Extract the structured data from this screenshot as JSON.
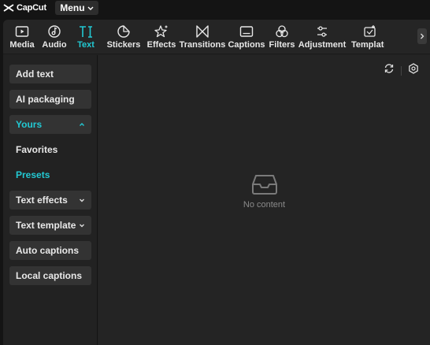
{
  "app": {
    "name": "CapCut",
    "menu_label": "Menu"
  },
  "toolbar": {
    "tools": [
      {
        "label": "Media",
        "icon": "media-icon"
      },
      {
        "label": "Audio",
        "icon": "audio-icon"
      },
      {
        "label": "Text",
        "icon": "text-icon",
        "active": true
      },
      {
        "label": "Stickers",
        "icon": "stickers-icon"
      },
      {
        "label": "Effects",
        "icon": "effects-icon"
      },
      {
        "label": "Transitions",
        "icon": "transitions-icon"
      },
      {
        "label": "Captions",
        "icon": "captions-icon"
      },
      {
        "label": "Filters",
        "icon": "filters-icon"
      },
      {
        "label": "Adjustment",
        "icon": "adjustment-icon"
      },
      {
        "label": "Templates",
        "icon": "templates-icon"
      }
    ]
  },
  "sidebar": {
    "items": [
      {
        "label": "Add text"
      },
      {
        "label": "AI packaging"
      },
      {
        "label": "Yours",
        "expanded": true
      },
      {
        "label": "Favorites"
      },
      {
        "label": "Presets",
        "selected": true
      },
      {
        "label": "Text effects"
      },
      {
        "label": "Text template"
      },
      {
        "label": "Auto captions"
      },
      {
        "label": "Local captions"
      }
    ]
  },
  "content": {
    "empty_text": "No content"
  },
  "colors": {
    "accent": "#22c9d3",
    "background": "#222222",
    "button": "#333333"
  }
}
